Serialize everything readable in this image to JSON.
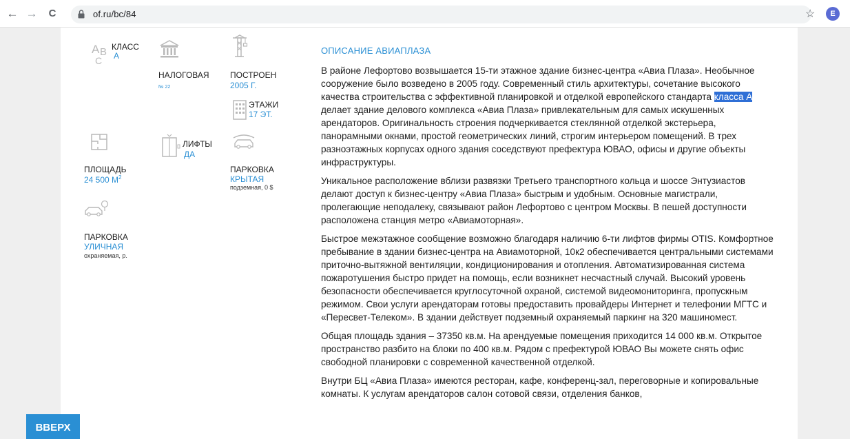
{
  "browser": {
    "url": "of.ru/bc/84",
    "profile_initial": "E",
    "back_glyph": "←",
    "forward_glyph": "→",
    "reload_glyph": "C",
    "star_glyph": "☆"
  },
  "icons": [
    "back-arrow-icon",
    "forward-arrow-icon",
    "reload-icon",
    "lock-icon",
    "star-icon",
    "building-class-icon",
    "bank-building-icon",
    "crane-icon",
    "floors-icon",
    "floor-plan-icon",
    "elevator-icon",
    "car-icon",
    "parking-car-icon"
  ],
  "specs": {
    "class": {
      "letters": [
        "A",
        "B",
        "C"
      ],
      "label": "КЛАСС",
      "value": "А"
    },
    "tax": {
      "label": "НАЛОГОВАЯ",
      "note": "№ 22"
    },
    "built": {
      "label": "ПОСТРОЕН",
      "value": "2005 Г."
    },
    "floors": {
      "label": "ЭТАЖИ",
      "value": "17 ЭТ."
    },
    "area": {
      "label": "ПЛОЩАДЬ",
      "value": "24 500 М",
      "sup": "2"
    },
    "lifts": {
      "label": "ЛИФТЫ",
      "value": "ДА"
    },
    "parking_covered": {
      "label": "ПАРКОВКА",
      "value": "КРЫТАЯ",
      "note": "подземная, 0 $"
    },
    "parking_street": {
      "label": "ПАРКОВКА",
      "value": "УЛИЧНАЯ",
      "note": "охраняемая, р."
    }
  },
  "description": {
    "title": "ОПИСАНИЕ АВИАПЛАЗА",
    "p1_before": "В районе Лефортово возвышается 15-ти этажное здание бизнес-центра «Авиа Плаза». Необычное сооружение было возведено в 2005 году. Современный стиль архитектуры, сочетание высокого качества строительства с эффективной планировкой и отделкой европейского стандарта ",
    "p1_highlight": "класса А",
    "p1_after": " делает здание делового комплекса «Авиа Плаза» привлекательным для самых искушенных арендаторов. Оригинальность строения подчеркивается стеклянной отделкой экстерьера, панорамными окнами, простой геометрических линий, строгим интерьером помещений. В трех разноэтажных корпусах одного здания соседствуют префектура ЮВАО, офисы и другие объекты инфраструктуры.",
    "p2": "Уникальное расположение вблизи развязки Третьего транспортного кольца и шоссе Энтузиастов делают доступ к бизнес-центру «Авиа Плаза» быстрым и удобным. Основные магистрали, пролегающие неподалеку, связывают район Лефортово с центром Москвы. В пешей доступности расположена станция метро «Авиамоторная».",
    "p3": "Быстрое межэтажное сообщение возможно благодаря наличию 6-ти лифтов фирмы OTIS. Комфортное пребывание в здании бизнес-центра на Авиамоторной, 10к2 обеспечивается центральными системами приточно-вытяжной вентиляции, кондиционирования и отопления. Автоматизированная система пожаротушения быстро придет на помощь, если возникнет несчастный случай. Высокий уровень безопасности обеспечивается круглосуточной охраной, системой видеомониторинга, пропускным режимом. Свои услуги арендаторам готовы предоставить провайдеры Интернет и телефонии МГТС и «Пересвет-Телеком». В здании действует подземный охраняемый паркинг на 320 машиномест.",
    "p4": "Общая площадь здания – 37350 кв.м. На арендуемые помещения приходится 14 000 кв.м. Открытое пространство разбито на блоки по 400 кв.м. Рядом с префектурой ЮВАО Вы можете снять офис свободной планировки с современной качественной отделкой.",
    "p5": "Внутри БЦ «Авиа Плаза» имеются ресторан, кафе, конференц-зал, переговорные и копировальные комнаты. К услугам арендаторов салон сотовой связи, отделения банков,"
  },
  "up_button": "ВВЕРХ",
  "colors": {
    "accent": "#2a8fd4",
    "highlight": "#2f6fd6",
    "icon": "#9aa0a6"
  }
}
